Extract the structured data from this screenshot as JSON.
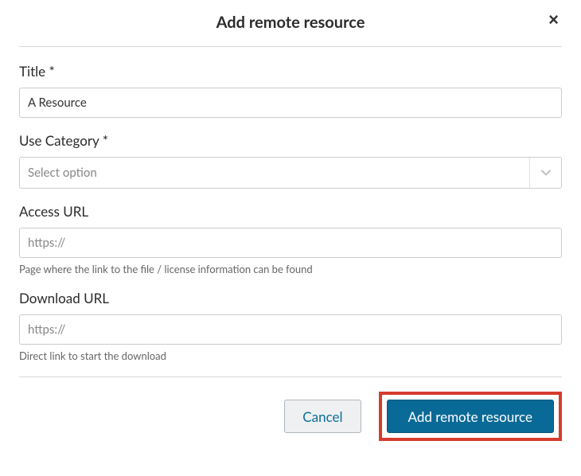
{
  "modal": {
    "title": "Add remote resource",
    "close": "×"
  },
  "fields": {
    "title": {
      "label": "Title *",
      "value": "A Resource"
    },
    "category": {
      "label": "Use Category *",
      "placeholder": "Select option"
    },
    "access": {
      "label": "Access URL",
      "placeholder": "https://",
      "help": "Page where the link to the file / license information can be found"
    },
    "download": {
      "label": "Download URL",
      "placeholder": "https://",
      "help": "Direct link to start the download"
    }
  },
  "buttons": {
    "cancel": "Cancel",
    "submit": "Add remote resource"
  }
}
